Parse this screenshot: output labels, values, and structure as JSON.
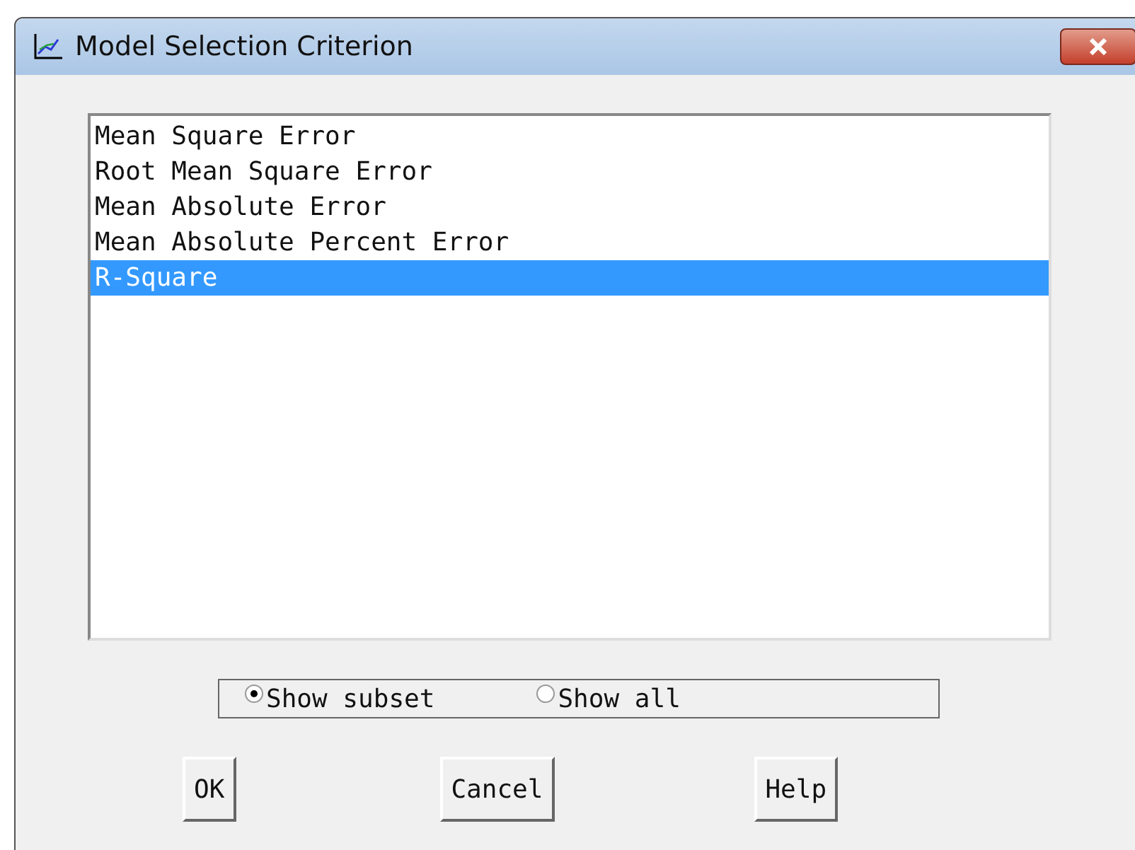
{
  "window": {
    "title": "Model Selection Criterion"
  },
  "criteria": [
    {
      "label": "Mean Square Error",
      "selected": false
    },
    {
      "label": "Root Mean Square Error",
      "selected": false
    },
    {
      "label": "Mean Absolute Error",
      "selected": false
    },
    {
      "label": "Mean Absolute Percent Error",
      "selected": false
    },
    {
      "label": "R-Square",
      "selected": true
    }
  ],
  "show_options": [
    {
      "label": "Show subset",
      "selected": true
    },
    {
      "label": "Show all",
      "selected": false
    }
  ],
  "buttons": [
    "OK",
    "Cancel",
    "Help"
  ]
}
